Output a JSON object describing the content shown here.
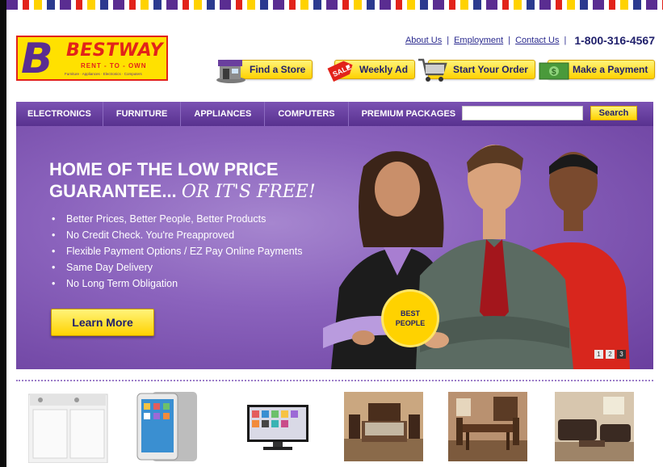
{
  "brand": {
    "letter": "B",
    "name": "BESTWAY",
    "sub": "RENT - TO - OWN",
    "tagline": "Furniture · Appliances · Electronics · Computers",
    "colors": {
      "purple": "#5a2d91",
      "yellow": "#ffe100",
      "red": "#e2231a"
    }
  },
  "toplinks": {
    "about": "About Us",
    "employment": "Employment",
    "contact": "Contact Us",
    "phone": "1-800-316-4567"
  },
  "actions": {
    "find_store": "Find a Store",
    "weekly_ad": "Weekly Ad",
    "sale_tag": "SALE",
    "start_order": "Start Your Order",
    "payment": "Make a Payment"
  },
  "nav": {
    "items": [
      "ELECTRONICS",
      "FURNITURE",
      "APPLIANCES",
      "COMPUTERS",
      "PREMIUM PACKAGES"
    ],
    "search_value": "",
    "search_button": "Search"
  },
  "hero": {
    "headline_1": "HOME OF THE LOW PRICE",
    "headline_2": "GUARANTEE...",
    "headline_free": "OR IT'S FREE!",
    "bullets": [
      "Better Prices, Better People, Better Products",
      "No Credit Check. You're Preapproved",
      "Flexible Payment Options / EZ Pay Online Payments",
      "Same Day Delivery",
      "No Long Term Obligation"
    ],
    "cta": "Learn More",
    "badge_1": "BEST",
    "badge_2": "PEOPLE",
    "slides": [
      "1",
      "2",
      "3"
    ]
  },
  "products": [
    "washer-dryer",
    "tablet",
    "television",
    "bedroom-set",
    "dining-set",
    "living-room-set"
  ]
}
